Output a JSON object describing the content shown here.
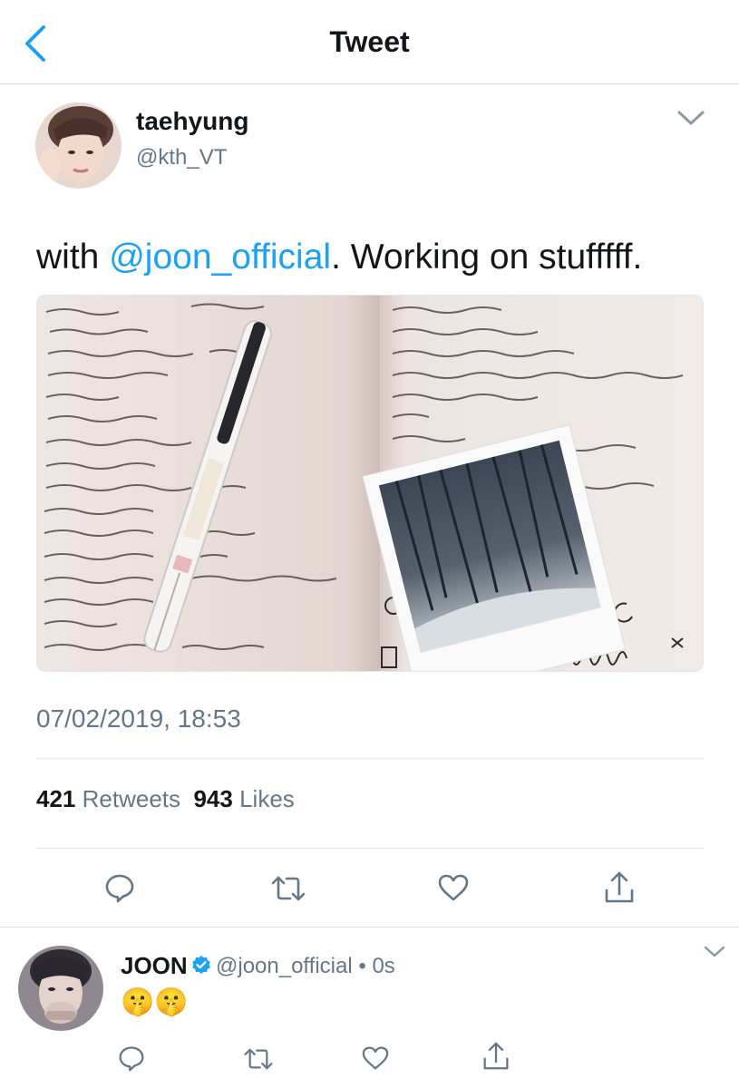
{
  "header": {
    "title": "Tweet"
  },
  "tweet": {
    "author_name": "taehyung",
    "author_handle": "@kth_VT",
    "text_prefix": "with ",
    "mention": "@joon_official",
    "text_suffix": ". Working on stufffff.",
    "timestamp": "07/02/2019, 18:53",
    "retweets_count": "421",
    "retweets_label": "Retweets",
    "likes_count": "943",
    "likes_label": "Likes"
  },
  "reply": {
    "author_name": "JOON",
    "author_handle": "@joon_official",
    "separator": "•",
    "time": "0s",
    "text": "🤫🤫"
  },
  "icons": {
    "back": "chevron-left-icon",
    "caret": "chevron-down-icon",
    "reply": "speech-bubble-icon",
    "retweet": "retweet-icon",
    "like": "heart-icon",
    "share": "share-icon",
    "verified": "verified-badge-icon"
  },
  "colors": {
    "accent": "#1da1f2",
    "text": "#14171a",
    "secondary": "#657786",
    "divider": "#e1e8ed"
  }
}
